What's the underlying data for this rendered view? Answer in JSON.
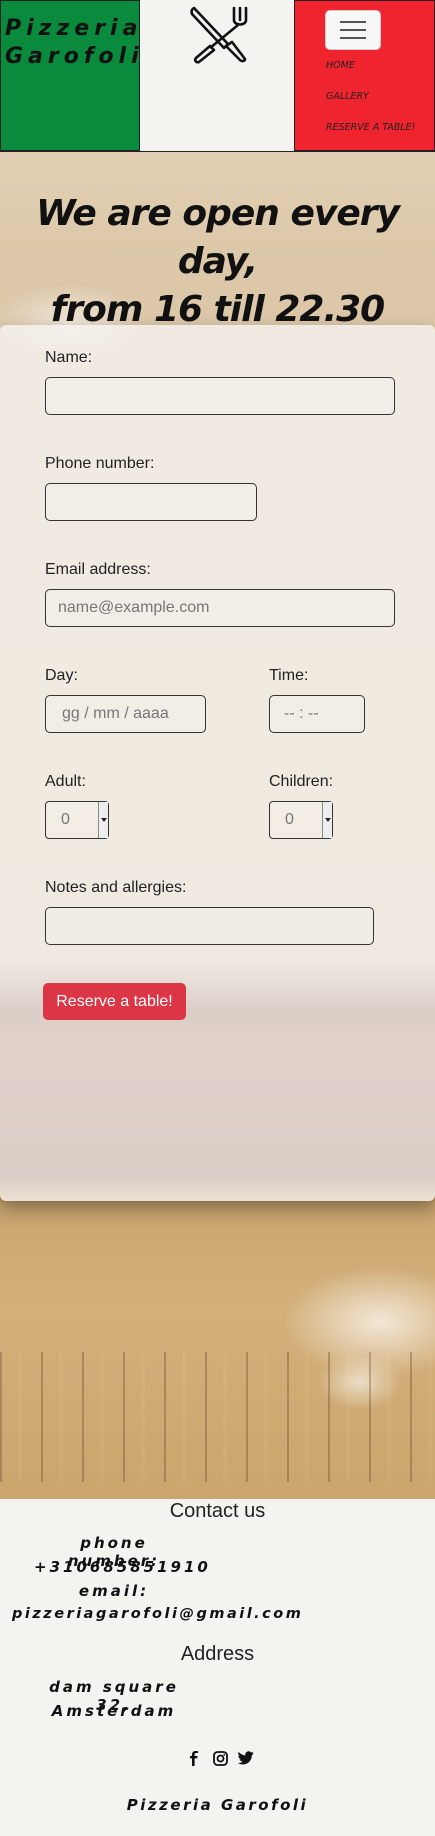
{
  "header": {
    "brand_line1": "Pizzeria",
    "brand_line2": "Garofoli",
    "logo_icon": "crossed-knife-fork-icon",
    "menu_icon": "hamburger-menu-icon",
    "nav_items": [
      "HOME",
      "GALLERY",
      "RESERVE A TABLE!"
    ],
    "colors": {
      "green": "#0a8a3c",
      "white": "#f3f3ef",
      "red": "#f0242e"
    }
  },
  "hero": {
    "headline_line1": "We are open every day,",
    "headline_line2": "from 16 till 22.30"
  },
  "form": {
    "name_label": "Name:",
    "phone_label": "Phone number:",
    "email_label": "Email address:",
    "email_placeholder": "name@example.com",
    "day_label": "Day:",
    "day_placeholder": "gg / mm / aaaa",
    "time_label": "Time:",
    "time_placeholder": "-- : --",
    "adult_label": "Adult:",
    "adult_value": "0",
    "children_label": "Children:",
    "children_value": "0",
    "notes_label": "Notes and allergies:",
    "submit_label": "Reserve a table!",
    "submit_color": "#dc3545"
  },
  "footer": {
    "contact_heading": "Contact us",
    "phone_label": "phone number:",
    "phone_value": "+310685851910",
    "email_label": "email:",
    "email_value": "pizzeriagarofoli@gmail.com",
    "address_heading": "Address",
    "address_line1": "dam square 32,",
    "address_line2": "Amsterdam",
    "social_icons": [
      "facebook-icon",
      "instagram-icon",
      "twitter-icon"
    ],
    "brand": "Pizzeria Garofoli"
  }
}
